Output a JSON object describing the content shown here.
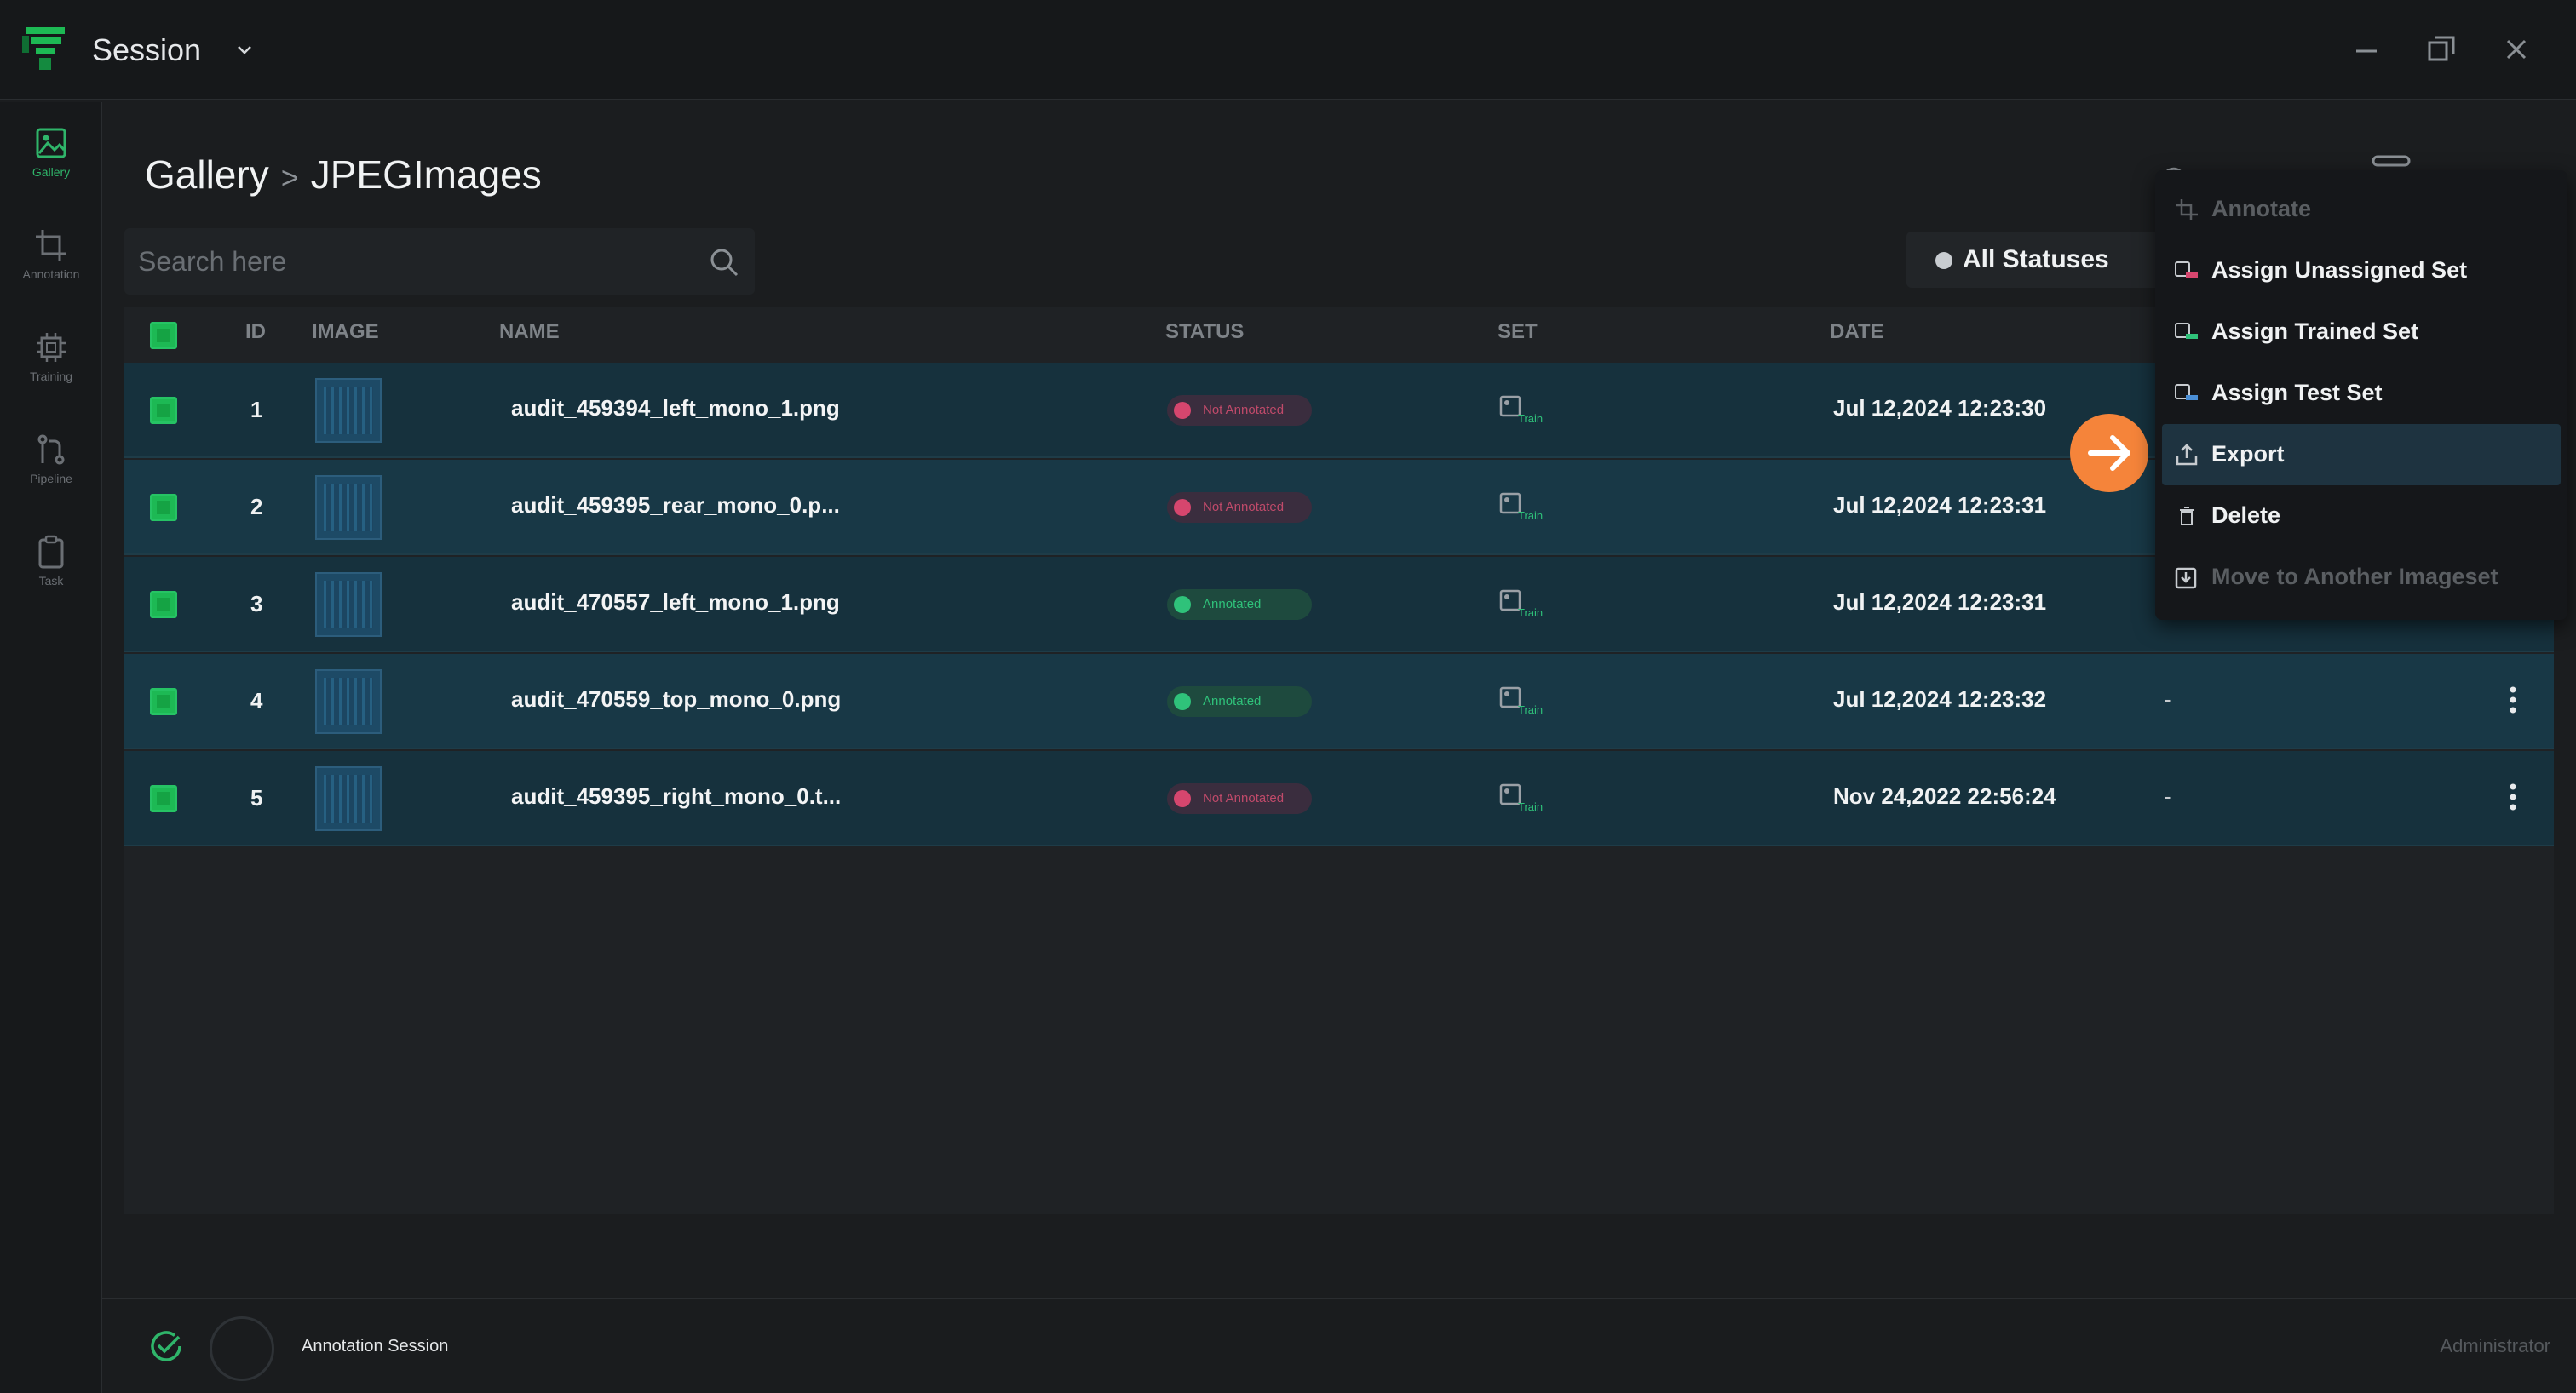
{
  "app": {
    "title": "Session",
    "brand_color": "#1db954"
  },
  "sidebar": {
    "items": [
      {
        "label": "Gallery",
        "icon": "gallery-icon",
        "active": true
      },
      {
        "label": "Annotation",
        "icon": "crop-icon",
        "active": false
      },
      {
        "label": "Training",
        "icon": "chip-icon",
        "active": false
      },
      {
        "label": "Pipeline",
        "icon": "pipeline-icon",
        "active": false
      },
      {
        "label": "Task",
        "icon": "clipboard-icon",
        "active": false
      }
    ]
  },
  "breadcrumb": {
    "root": "Gallery",
    "separator": ">",
    "current": "JPEGImages"
  },
  "search": {
    "placeholder": "Search here",
    "value": ""
  },
  "filter": {
    "status_label": "All Statuses"
  },
  "table": {
    "columns": {
      "id": "ID",
      "image": "IMAGE",
      "name": "NAME",
      "status": "STATUS",
      "set": "SET",
      "date": "DATE"
    },
    "rows": [
      {
        "id": "1",
        "name": "audit_459394_left_mono_1.png",
        "status": "Not Annotated",
        "set": "Train",
        "date": "Jul 12,2024 12:23:30",
        "extra": ""
      },
      {
        "id": "2",
        "name": "audit_459395_rear_mono_0.p...",
        "status": "Not Annotated",
        "set": "Train",
        "date": "Jul 12,2024 12:23:31",
        "extra": ""
      },
      {
        "id": "3",
        "name": "audit_470557_left_mono_1.png",
        "status": "Annotated",
        "set": "Train",
        "date": "Jul 12,2024 12:23:31",
        "extra": ""
      },
      {
        "id": "4",
        "name": "audit_470559_top_mono_0.png",
        "status": "Annotated",
        "set": "Train",
        "date": "Jul 12,2024 12:23:32",
        "extra": "-"
      },
      {
        "id": "5",
        "name": "audit_459395_right_mono_0.t...",
        "status": "Not Annotated",
        "set": "Train",
        "date": "Nov 24,2022 22:56:24",
        "extra": "-"
      }
    ]
  },
  "context_menu": {
    "items": [
      {
        "label": "Annotate",
        "icon": "crop-icon",
        "disabled": true
      },
      {
        "label": "Assign Unassigned Set",
        "icon": "unassigned-set-icon",
        "disabled": false
      },
      {
        "label": "Assign Trained Set",
        "icon": "train-set-icon",
        "disabled": false
      },
      {
        "label": "Assign Test Set",
        "icon": "test-set-icon",
        "disabled": false
      },
      {
        "label": "Export",
        "icon": "export-icon",
        "disabled": false,
        "highlighted": true
      },
      {
        "label": "Delete",
        "icon": "trash-icon",
        "disabled": false
      },
      {
        "label": "Move to Another Imageset",
        "icon": "move-icon",
        "disabled": true
      }
    ]
  },
  "statusbar": {
    "session_label": "Annotation Session",
    "user_label": "Administrator"
  },
  "colors": {
    "accent": "#1db954",
    "annotated": "#2fc27a",
    "not_annotated": "#d6466e",
    "row_bg": "#16313d",
    "hint": "#f5843a"
  }
}
